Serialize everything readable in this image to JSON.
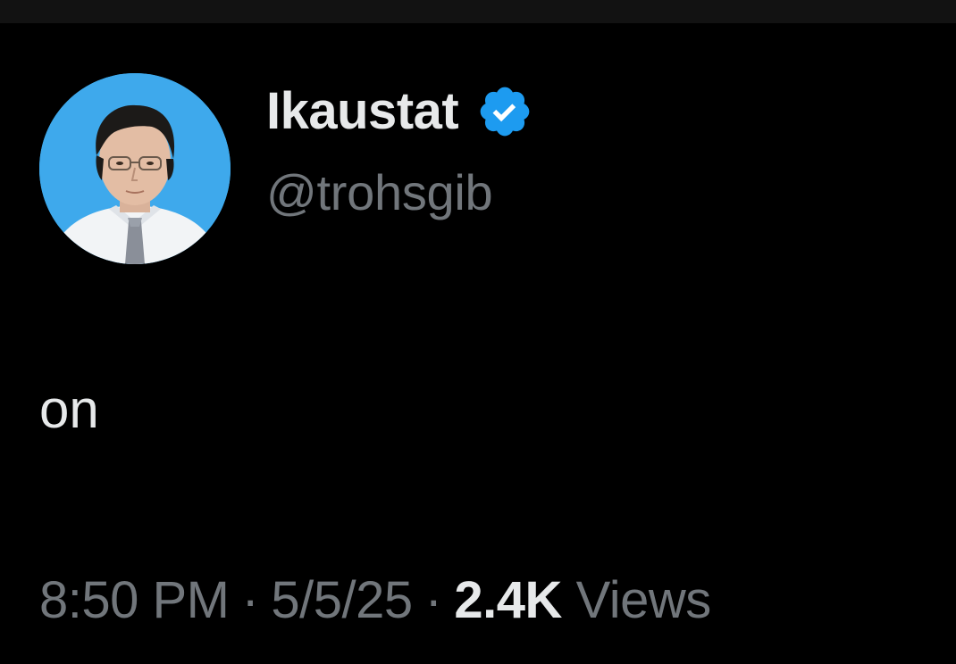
{
  "tweet": {
    "author": {
      "display_name": "Ikaustat",
      "handle": "@trohsgib",
      "verified": true,
      "verified_icon": "verified-badge-icon",
      "avatar": "avatar-photo"
    },
    "text": "on",
    "meta": {
      "time": "8:50 PM",
      "separator": "·",
      "date": "5/5/25",
      "views_count": "2.4K",
      "views_label": "Views"
    }
  },
  "colors": {
    "background": "#000000",
    "primary_text": "#e7e9ea",
    "secondary_text": "#71767b",
    "verified_blue": "#1d9bf0",
    "avatar_background": "#3ea9ec"
  }
}
